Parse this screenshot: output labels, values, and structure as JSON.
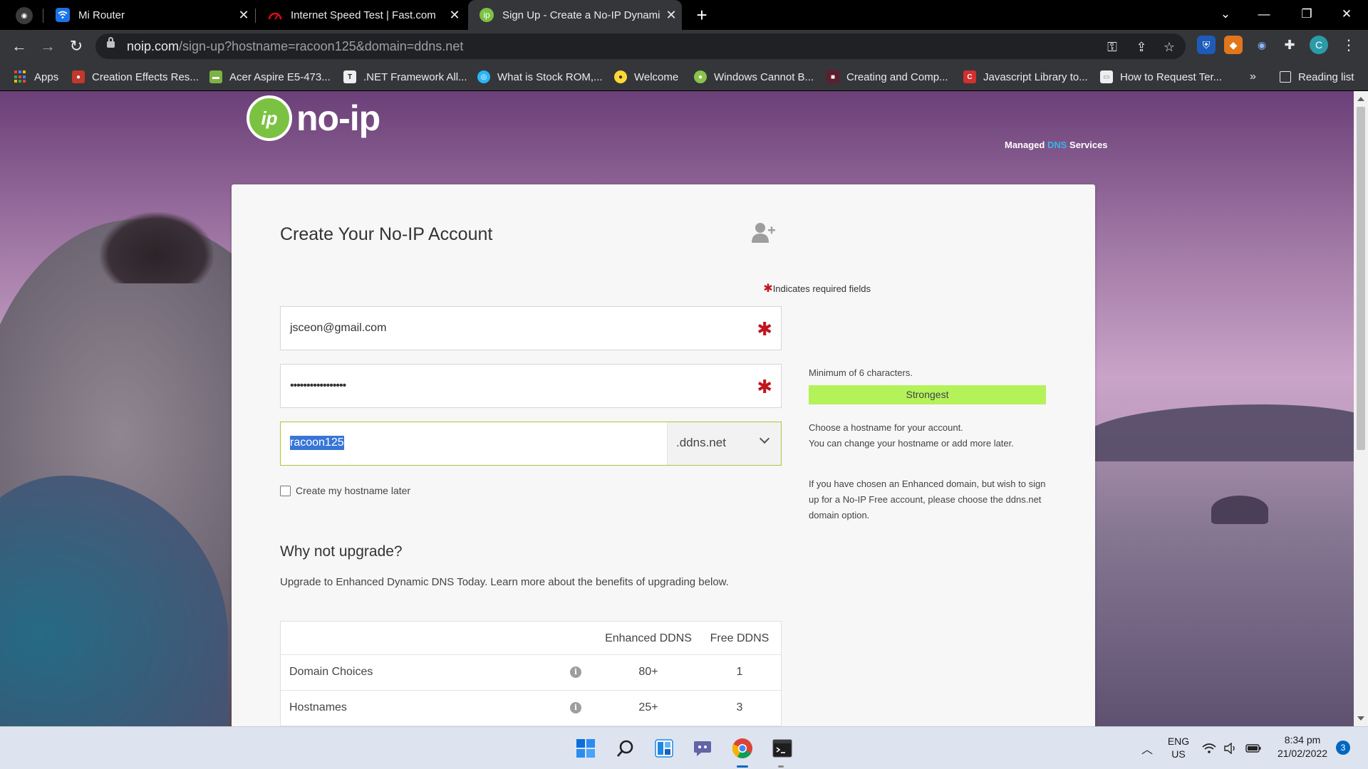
{
  "tabs": [
    {
      "title": "Mi Router",
      "icon": "wifi-icon",
      "color": "#1a73e8"
    },
    {
      "title": "Internet Speed Test | Fast.com",
      "icon": "speedometer-icon",
      "color": "#e50914"
    },
    {
      "title": "Sign Up - Create a No-IP Dynami",
      "icon": "noip-icon",
      "color": "#7cc242",
      "active": true
    }
  ],
  "address": {
    "host": "noip.com",
    "path": "/sign-up?hostname=racoon125&domain=ddns.net"
  },
  "bookmarks": [
    {
      "label": "Apps"
    },
    {
      "label": "Creation Effects Res...",
      "color": "#c0392b"
    },
    {
      "label": "Acer Aspire E5-473...",
      "color": "#7cb342"
    },
    {
      "label": ".NET Framework All...",
      "color": "#eeeeee"
    },
    {
      "label": "What is Stock ROM,...",
      "color": "#29b6f6"
    },
    {
      "label": "Welcome",
      "color": "#fdd835"
    },
    {
      "label": "Windows Cannot B...",
      "color": "#8bc34a"
    },
    {
      "label": "Creating and Comp...",
      "color": "#5d1e2e"
    },
    {
      "label": "Javascript Library to...",
      "color": "#d32f2f"
    },
    {
      "label": "How to Request Ter...",
      "color": "#eeeeee"
    }
  ],
  "bookmarks_more": "»",
  "reading_list": "Reading list",
  "site": {
    "logo_mark": "ip",
    "logo_text": "no-ip",
    "tagline_pre": "Managed ",
    "tagline_dns": "DNS",
    "tagline_post": " Services"
  },
  "form": {
    "title": "Create Your No-IP Account",
    "required_note": "Indicates required fields",
    "required_star": "✱",
    "email": "jsceon@gmail.com",
    "password": "•••••••••••••••••",
    "hostname": "racoon125",
    "domain": ".ddns.net",
    "checkbox_label": "Create my hostname later",
    "pw_hint": "Minimum of 6 characters.",
    "strength": "Strongest",
    "host_hint_1": "Choose a hostname for your account.",
    "host_hint_2": "You can change your hostname or add more later.",
    "enhanced_note_1": "If you have chosen an Enhanced domain, but wish to sign",
    "enhanced_note_2": "up for a No-IP Free account, please choose the ddns.net",
    "enhanced_note_3": "domain option."
  },
  "upgrade": {
    "title": "Why not upgrade?",
    "subtitle": "Upgrade to Enhanced Dynamic DNS Today. Learn more about the benefits of upgrading below.",
    "columns": [
      "",
      "Enhanced DDNS",
      "Free DDNS"
    ],
    "rows": [
      {
        "feature": "Domain Choices",
        "enhanced": "80+",
        "free": "1"
      },
      {
        "feature": "Hostnames",
        "enhanced": "25+",
        "free": "3"
      }
    ]
  },
  "tray": {
    "lang_1": "ENG",
    "lang_2": "US",
    "time": "8:34 pm",
    "date": "21/02/2022",
    "notifications": "3"
  },
  "colors": {
    "accent": "#7cc242",
    "strength": "#b4f25a",
    "required": "#c0161d",
    "selection": "#3875d7"
  }
}
